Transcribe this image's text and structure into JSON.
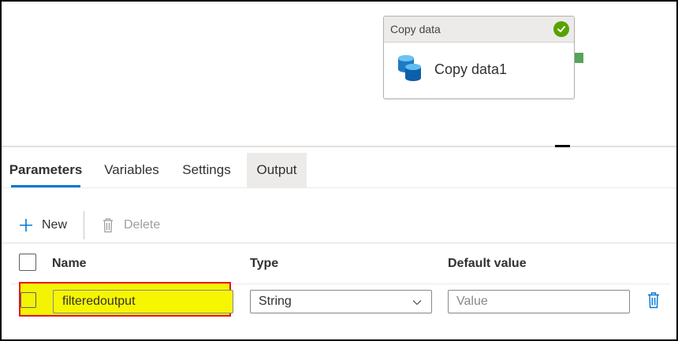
{
  "canvas": {
    "activity": {
      "type_label": "Copy data",
      "name": "Copy data1",
      "status": "succeeded",
      "icon": "database-copy-icon",
      "status_color": "#57a300"
    }
  },
  "tabs": [
    {
      "label": "Parameters",
      "active": true
    },
    {
      "label": "Variables",
      "active": false
    },
    {
      "label": "Settings",
      "active": false
    },
    {
      "label": "Output",
      "active": false
    }
  ],
  "toolbar": {
    "new_label": "New",
    "delete_label": "Delete",
    "new_icon": "plus-icon",
    "delete_icon": "trash-icon"
  },
  "table": {
    "columns": [
      "Name",
      "Type",
      "Default value"
    ],
    "rows": [
      {
        "name": "filteredoutput",
        "type": "String",
        "default_value_placeholder": "Value",
        "default_value": ""
      }
    ]
  },
  "colors": {
    "accent": "#0078d4",
    "highlight_fill": "#f3f303",
    "highlight_border": "#e81123"
  }
}
